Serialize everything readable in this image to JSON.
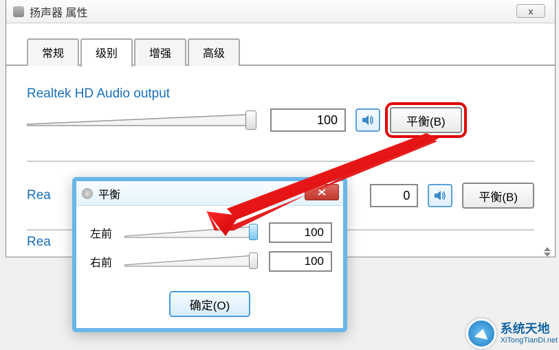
{
  "window": {
    "title": "扬声器 属性",
    "close": "x"
  },
  "tabs": {
    "general": "常规",
    "levels": "级别",
    "enhance": "增强",
    "advanced": "高级"
  },
  "output1": {
    "label": "Realtek HD Audio output",
    "value": "100",
    "balance_btn": "平衡(B)"
  },
  "output2": {
    "label_partial": "Rea",
    "value": "0",
    "balance_btn": "平衡(B)"
  },
  "output3": {
    "label_partial": "Rea"
  },
  "popup": {
    "title": "平衡",
    "left_label": "左前",
    "left_value": "100",
    "right_label": "右前",
    "right_value": "100",
    "ok": "确定(O)"
  },
  "watermark": {
    "main": "系统天地",
    "sub": "XiTongTianDi.net"
  }
}
